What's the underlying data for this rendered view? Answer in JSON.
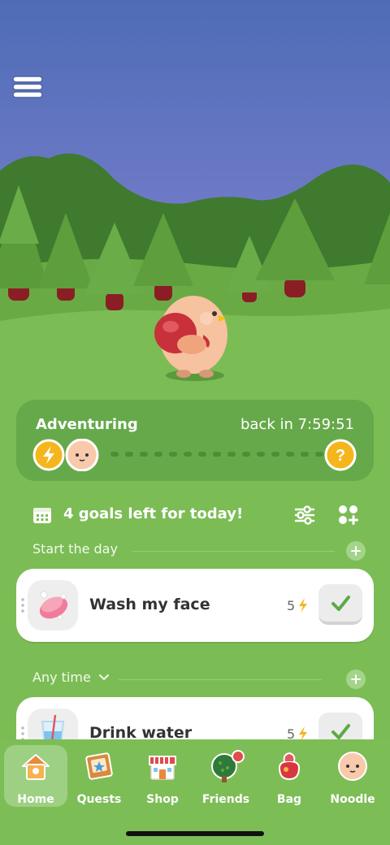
{
  "colors": {
    "sky_top": "#4e6cb5",
    "sky_bottom": "#8a86d6",
    "grass": "#7cbc55",
    "card_bg": "#66a94a",
    "energy_yellow": "#f5b51c",
    "check_green": "#5aaa46"
  },
  "adventure": {
    "title": "Adventuring",
    "return_text": "back in 7:59:51",
    "mystery_icon": "question-mark-icon",
    "energy_icon": "lightning-icon"
  },
  "goals": {
    "summary": "4 goals left for today!",
    "calendar_icon": "calendar-icon",
    "filter_icon": "sliders-icon",
    "add_widget_icon": "grid-plus-icon"
  },
  "sections": [
    {
      "label": "Start the day",
      "tasks": [
        {
          "name": "Wash my face",
          "energy": "5",
          "icon": "soap-icon",
          "check_icon": "checkmark-icon"
        }
      ]
    },
    {
      "label": "Any time",
      "chevron": "chevron-down-icon",
      "tasks": [
        {
          "name": "Drink water",
          "energy": "5",
          "icon": "glass-of-water-icon",
          "check_icon": "checkmark-icon"
        }
      ]
    }
  ],
  "tabs": [
    {
      "label": "Home",
      "icon": "house-icon",
      "active": true
    },
    {
      "label": "Quests",
      "icon": "quest-board-icon"
    },
    {
      "label": "Shop",
      "icon": "shop-icon"
    },
    {
      "label": "Friends",
      "icon": "tree-icon",
      "notification": true
    },
    {
      "label": "Bag",
      "icon": "bag-icon"
    },
    {
      "label": "Noodle",
      "icon": "noodle-face-icon"
    }
  ]
}
